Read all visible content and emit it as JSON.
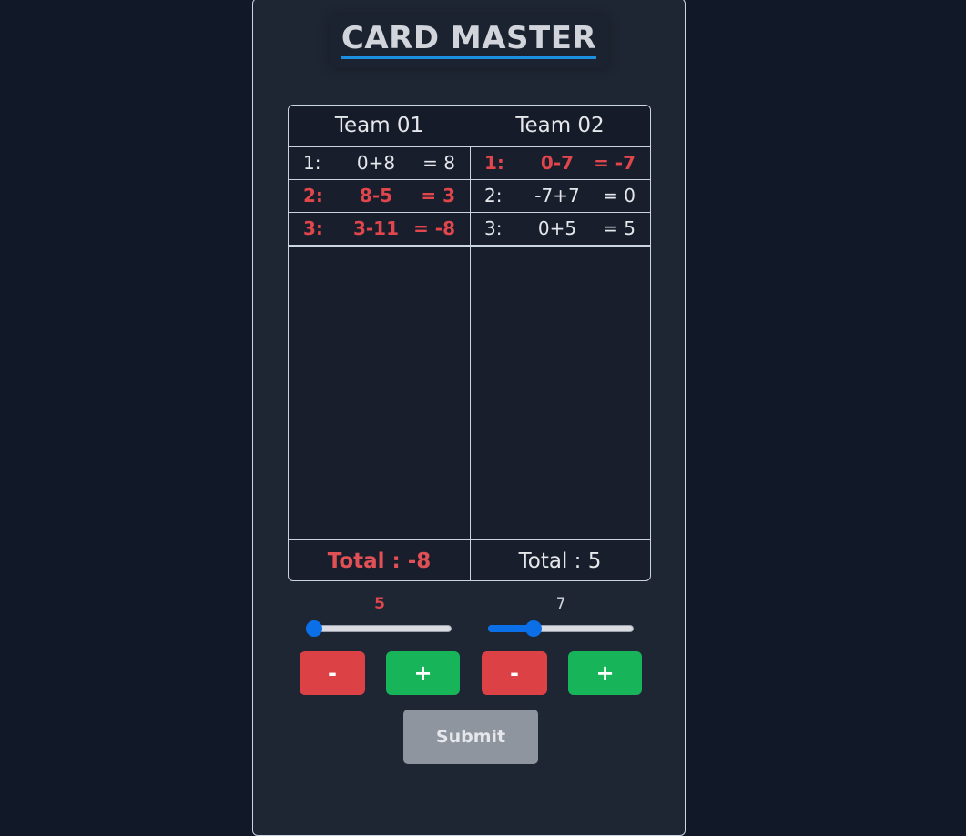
{
  "app": {
    "title": "CARD MASTER"
  },
  "teams": [
    {
      "name": "Team 01",
      "rounds": [
        {
          "round": "1:",
          "expr": "0+8",
          "result": "= 8",
          "negative": false
        },
        {
          "round": "2:",
          "expr": "8-5",
          "result": "= 3",
          "negative": true
        },
        {
          "round": "3:",
          "expr": "3-11",
          "result": "= -8",
          "negative": true
        }
      ],
      "total": "Total : -8",
      "total_negative": true,
      "slider_value": "5",
      "slider_fraction": 0.0
    },
    {
      "name": "Team 02",
      "rounds": [
        {
          "round": "1:",
          "expr": "0-7",
          "result": "= -7",
          "negative": true
        },
        {
          "round": "2:",
          "expr": "-7+7",
          "result": "= 0",
          "negative": false
        },
        {
          "round": "3:",
          "expr": "0+5",
          "result": "= 5",
          "negative": false
        }
      ],
      "total": "Total : 5",
      "total_negative": false,
      "slider_value": "7",
      "slider_fraction": 0.29
    }
  ],
  "controls": {
    "minus_label": "-",
    "plus_label": "+",
    "submit_label": "Submit"
  },
  "colors": {
    "accent_blue": "#0b6fe8",
    "negative_red": "#e0464c",
    "minus_red": "#dc4146",
    "plus_green": "#18b45a",
    "submit_gray": "#8e959f"
  }
}
